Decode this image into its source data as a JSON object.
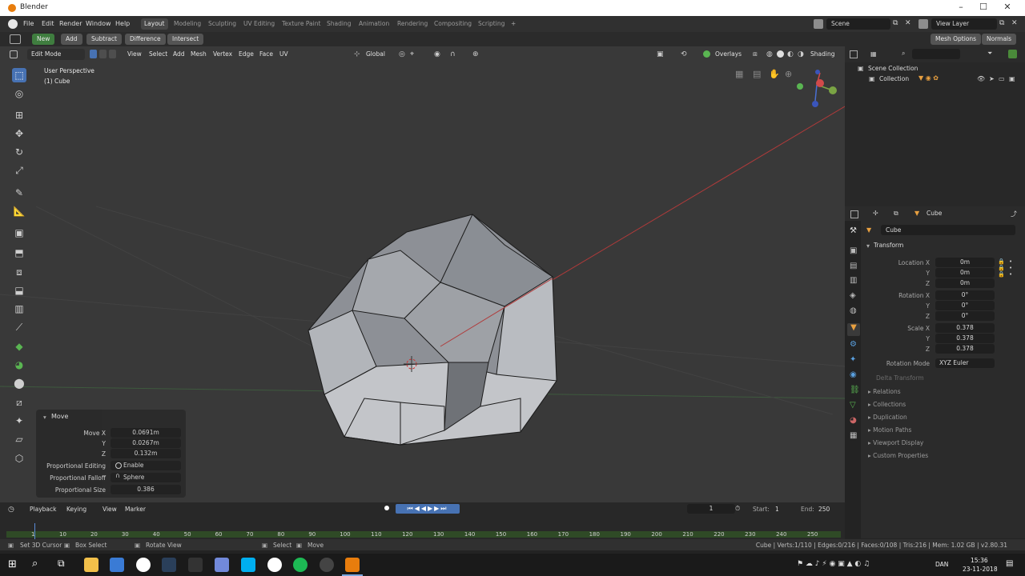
{
  "window": {
    "title": "Blender"
  },
  "menu": {
    "items": [
      "File",
      "Edit",
      "Render",
      "Window",
      "Help"
    ]
  },
  "workspaces": [
    "Layout",
    "Modeling",
    "Sculpting",
    "UV Editing",
    "Texture Paint",
    "Shading",
    "Animation",
    "Rendering",
    "Compositing",
    "Scripting"
  ],
  "active_workspace": "Layout",
  "scene": {
    "scene_name": "Scene",
    "view_layer": "View Layer"
  },
  "tool_header": {
    "new": "New",
    "add": "Add",
    "subtract": "Subtract",
    "difference": "Difference",
    "intersect": "Intersect",
    "mesh_options": "Mesh Options",
    "normals": "Normals"
  },
  "viewport_header": {
    "mode": "Edit Mode",
    "menus": [
      "View",
      "Select",
      "Add",
      "Mesh",
      "Vertex",
      "Edge",
      "Face",
      "UV"
    ],
    "orientation": "Global",
    "overlays": "Overlays",
    "shading": "Shading"
  },
  "viewport": {
    "perspective": "User Perspective",
    "object": "(1) Cube"
  },
  "operator_panel": {
    "title": "Move",
    "move_x_label": "Move X",
    "move_x": "0.0691m",
    "y_label": "Y",
    "y": "0.0267m",
    "z_label": "Z",
    "z": "0.132m",
    "prop_editing_label": "Proportional Editing",
    "prop_editing": "Enable",
    "prop_falloff_label": "Proportional Falloff",
    "prop_falloff": "Sphere",
    "prop_size_label": "Proportional Size",
    "prop_size": "0.386"
  },
  "outliner": {
    "scene_collection": "Scene Collection",
    "collection": "Collection"
  },
  "properties": {
    "breadcrumb": "Cube",
    "object_name": "Cube",
    "transform_title": "Transform",
    "location_label": "Location X",
    "location": [
      "0m",
      "0m",
      "0m"
    ],
    "rotation_label": "Rotation X",
    "rotation": [
      "0°",
      "0°",
      "0°"
    ],
    "scale_label": "Scale X",
    "scale": [
      "0.378",
      "0.378",
      "0.378"
    ],
    "y_label": "Y",
    "z_label": "Z",
    "rotation_mode_label": "Rotation Mode",
    "rotation_mode": "XYZ Euler",
    "delta_transform": "Delta Transform",
    "sections": [
      "Relations",
      "Collections",
      "Duplication",
      "Motion Paths",
      "Viewport Display",
      "Custom Properties"
    ]
  },
  "timeline": {
    "menus": [
      "Playback",
      "Keying",
      "View",
      "Marker"
    ],
    "current_frame": "1",
    "start_label": "Start:",
    "start": "1",
    "end_label": "End:",
    "end": "250",
    "ticks": [
      "1",
      "10",
      "20",
      "30",
      "40",
      "50",
      "60",
      "70",
      "80",
      "90",
      "100",
      "110",
      "120",
      "130",
      "140",
      "150",
      "160",
      "170",
      "180",
      "190",
      "200",
      "210",
      "220",
      "230",
      "240",
      "250"
    ]
  },
  "status": {
    "left1": "Set 3D Cursor",
    "left2": "Box Select",
    "left3": "Rotate View",
    "mid1": "Select",
    "mid2": "Move",
    "right": "Cube | Verts:1/110 | Edges:0/216 | Faces:0/108 | Tris:216 | Mem: 1.02 GB | v2.80.31"
  },
  "taskbar": {
    "time": "15:36",
    "date": "23-11-2018",
    "lang": "DAN"
  },
  "colors": {
    "accent": "#4772b3",
    "green": "#3f7d3f",
    "orange": "#e87d0d"
  }
}
